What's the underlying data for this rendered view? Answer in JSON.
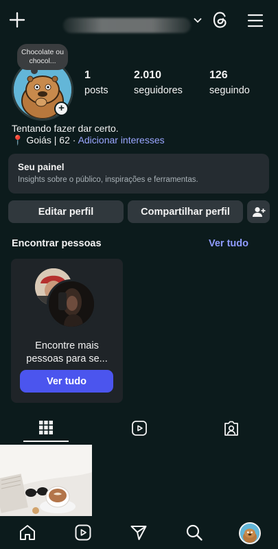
{
  "note": {
    "text": "Chocolate ou chocol..."
  },
  "stats": [
    {
      "value": "1",
      "label": "posts"
    },
    {
      "value": "2.010",
      "label": "seguidores"
    },
    {
      "value": "126",
      "label": "seguindo"
    }
  ],
  "bio": {
    "text": "Tentando fazer dar certo.",
    "location": "📍 Goiás | 62 ·",
    "interests_link": "Adicionar interesses"
  },
  "dashboard": {
    "title": "Seu painel",
    "subtitle": "Insights sobre o público, inspirações e ferramentas."
  },
  "actions": {
    "edit_profile": "Editar perfil",
    "share_profile": "Compartilhar perfil"
  },
  "discover": {
    "title": "Encontrar pessoas",
    "see_all": "Ver tudo",
    "card_text": "Encontre mais pessoas para se...",
    "card_button": "Ver tudo"
  },
  "colors": {
    "background": "#0c1b1c",
    "accent": "#4b55ee",
    "link": "#8f9bff"
  }
}
